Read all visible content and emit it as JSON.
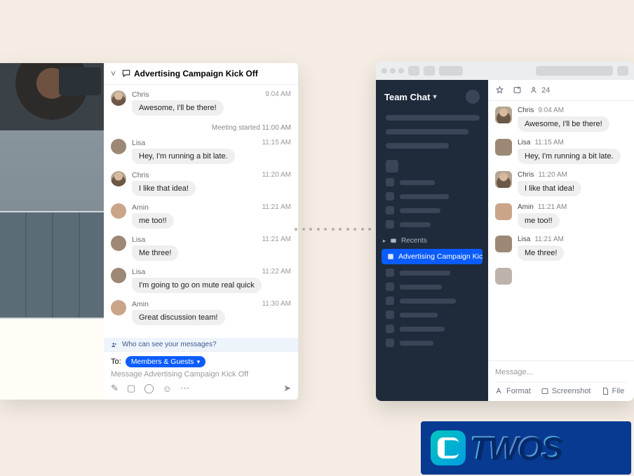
{
  "left": {
    "header_title": "Advertising Campaign Kick Off",
    "system_note": "Meeting started 11:00 AM",
    "messages": [
      {
        "sender": "Chris",
        "time": "9:04 AM",
        "text": "Awesome, I'll be there!"
      },
      {
        "sender": "Lisa",
        "time": "11:15 AM",
        "text": "Hey, I'm running a bit late."
      },
      {
        "sender": "Chris",
        "time": "11:20 AM",
        "text": "I like that idea!"
      },
      {
        "sender": "Amin",
        "time": "11:21 AM",
        "text": "me too!!"
      },
      {
        "sender": "Lisa",
        "time": "11:21 AM",
        "text": "Me three!"
      },
      {
        "sender": "Lisa",
        "time": "11:22 AM",
        "text": "I'm going to go on mute real quick"
      },
      {
        "sender": "Amin",
        "time": "11:30 AM",
        "text": "Great discussion team!"
      }
    ],
    "info_banner": "Who can see your messages?",
    "composer": {
      "to_label": "To:",
      "chip": "Members & Guests",
      "placeholder": "Message Advertising Campaign Kick Off"
    }
  },
  "right": {
    "sidebar": {
      "title": "Team Chat",
      "section_label": "Recents",
      "active_channel": "Advertising Campaign Kick..."
    },
    "toolbar": {
      "members_count": "24"
    },
    "messages": [
      {
        "sender": "Chris",
        "time": "9:04 AM",
        "text": "Awesome, I'll be there!"
      },
      {
        "sender": "Lisa",
        "time": "11:15 AM",
        "text": "Hey, I'm running a bit late."
      },
      {
        "sender": "Chris",
        "time": "11:20 AM",
        "text": "I like that idea!"
      },
      {
        "sender": "Amin",
        "time": "11:21 AM",
        "text": "me too!!"
      },
      {
        "sender": "Lisa",
        "time": "11:21 AM",
        "text": "Me three!"
      }
    ],
    "composer": {
      "placeholder": "Message...",
      "format_label": "Format",
      "screenshot_label": "Screenshot",
      "file_label": "File"
    }
  },
  "watermark": "TWOS"
}
